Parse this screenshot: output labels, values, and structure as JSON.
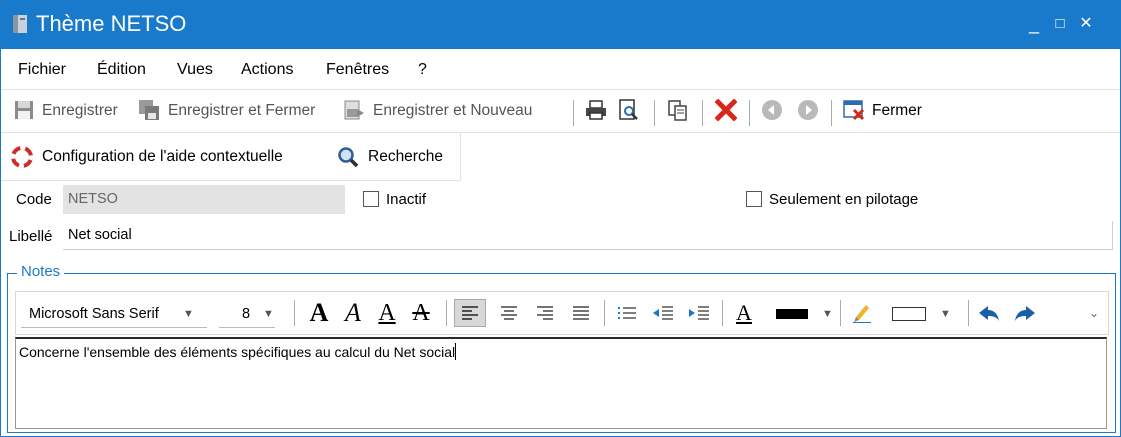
{
  "window": {
    "title": "Thème NETSO",
    "controls": [
      "_",
      "□",
      "✕"
    ]
  },
  "menu": [
    "Fichier",
    "Édition",
    "Vues",
    "Actions",
    "Fenêtres",
    "?"
  ],
  "toolbar": {
    "save": "Enregistrer",
    "save_close": "Enregistrer et Fermer",
    "save_new": "Enregistrer et Nouveau",
    "close": "Fermer"
  },
  "toolbar2": {
    "help_config": "Configuration de l'aide contextuelle",
    "search": "Recherche"
  },
  "form": {
    "code_label": "Code",
    "code_value": "NETSO",
    "inactive_label": "Inactif",
    "inactive_checked": false,
    "pilot_label": "Seulement en pilotage",
    "pilot_checked": false,
    "libelle_label": "Libellé",
    "libelle_value": "Net social"
  },
  "notes": {
    "legend": "Notes",
    "font_name": "Microsoft Sans Serif",
    "font_size": "8",
    "text": "Concerne l'ensemble des éléments spécifiques au calcul du Net social"
  },
  "colors": {
    "accent": "#1979ca",
    "font_color": "#000000",
    "delete_red": "#d9261c"
  }
}
